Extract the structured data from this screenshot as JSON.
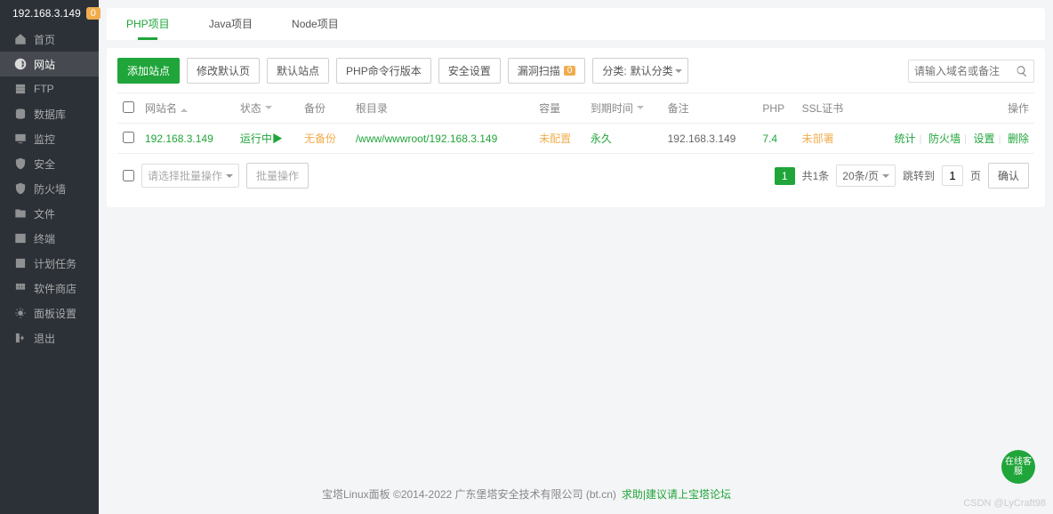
{
  "header": {
    "ip": "192.168.3.149",
    "badge": "0"
  },
  "sidebar": {
    "items": [
      {
        "label": "首页",
        "icon": "home"
      },
      {
        "label": "网站",
        "icon": "globe",
        "active": true
      },
      {
        "label": "FTP",
        "icon": "ftp"
      },
      {
        "label": "数据库",
        "icon": "database"
      },
      {
        "label": "监控",
        "icon": "monitor"
      },
      {
        "label": "安全",
        "icon": "shield"
      },
      {
        "label": "防火墙",
        "icon": "firewall"
      },
      {
        "label": "文件",
        "icon": "folder"
      },
      {
        "label": "终端",
        "icon": "terminal"
      },
      {
        "label": "计划任务",
        "icon": "task"
      },
      {
        "label": "软件商店",
        "icon": "store"
      },
      {
        "label": "面板设置",
        "icon": "settings"
      },
      {
        "label": "退出",
        "icon": "logout"
      }
    ]
  },
  "tabs": [
    {
      "label": "PHP项目",
      "active": true
    },
    {
      "label": "Java项目"
    },
    {
      "label": "Node项目"
    }
  ],
  "toolbar": {
    "add": "添加站点",
    "modify_default": "修改默认页",
    "default_site": "默认站点",
    "php_cli": "PHP命令行版本",
    "security": "安全设置",
    "vuln_scan": "漏洞扫描",
    "vuln_badge": "0",
    "category_prefix": "分类:",
    "category_value": "默认分类",
    "search_placeholder": "请输入域名或备注"
  },
  "columns": {
    "name": "网站名",
    "status": "状态",
    "backup": "备份",
    "root": "根目录",
    "capacity": "容量",
    "expire": "到期时间",
    "remark": "备注",
    "php": "PHP",
    "ssl": "SSL证书",
    "ops": "操作"
  },
  "rows": [
    {
      "name": "192.168.3.149",
      "status": "运行中▶",
      "backup": "无备份",
      "root": "/www/wwwroot/192.168.3.149",
      "capacity": "未配置",
      "expire": "永久",
      "remark": "192.168.3.149",
      "php": "7.4",
      "ssl": "未部署",
      "ops": {
        "stat": "统计",
        "waf": "防火墙",
        "set": "设置",
        "del": "删除"
      }
    }
  ],
  "batch": {
    "select_placeholder": "请选择批量操作",
    "exec": "批量操作"
  },
  "pager": {
    "page": "1",
    "total_label": "共1条",
    "per_page": "20条/页",
    "jump_label": "跳转到",
    "jump_value": "1",
    "page_suffix": "页",
    "confirm": "确认"
  },
  "footer": {
    "text": "宝塔Linux面板 ©2014-2022 广东堡塔安全技术有限公司 (bt.cn)",
    "help": "求助|建议请上宝塔论坛"
  },
  "watermark": "CSDN @LyCraft98",
  "fab": "在线客服"
}
